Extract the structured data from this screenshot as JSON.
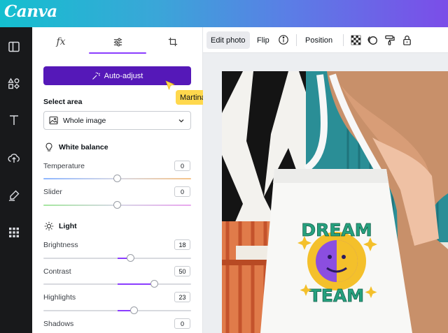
{
  "app": {
    "logo": "Canva",
    "brand_colors": {
      "accent": "#8b3dff",
      "button": "#5518b8",
      "rail": "#18191b"
    }
  },
  "rail": {
    "items": [
      {
        "icon": "layout-icon"
      },
      {
        "icon": "elements-icon"
      },
      {
        "icon": "text-icon"
      },
      {
        "icon": "upload-cloud-icon"
      },
      {
        "icon": "draw-icon"
      },
      {
        "icon": "apps-grid-icon"
      }
    ]
  },
  "panel": {
    "tabs": [
      {
        "label": "fx",
        "icon": "effects-icon"
      },
      {
        "icon": "adjust-sliders-icon",
        "selected": true
      },
      {
        "icon": "crop-icon"
      }
    ],
    "auto_adjust_label": "Auto-adjust",
    "select_area": {
      "title": "Select area",
      "value": "Whole image"
    },
    "white_balance": {
      "title": "White balance",
      "sliders": [
        {
          "label": "Temperature",
          "value": "0",
          "level": 0.5
        },
        {
          "label": "Slider",
          "value": "0",
          "level": 0.5
        }
      ]
    },
    "light": {
      "title": "Light",
      "sliders": [
        {
          "label": "Brightness",
          "value": "18",
          "level": 0.59
        },
        {
          "label": "Contrast",
          "value": "50",
          "level": 0.75
        },
        {
          "label": "Highlights",
          "value": "23",
          "level": 0.615
        },
        {
          "label": "Shadows",
          "value": "0",
          "level": 0.5
        }
      ]
    }
  },
  "toolbar": {
    "edit_photo": "Edit photo",
    "flip": "Flip",
    "position": "Position",
    "icons": [
      "info-icon",
      "transparency-icon",
      "animate-icon",
      "paint-roller-icon",
      "lock-icon"
    ]
  },
  "collaborator": {
    "name": "Martina"
  },
  "photo": {
    "tote_text_line1": "DREAM",
    "tote_text_line2": "TEAM"
  }
}
